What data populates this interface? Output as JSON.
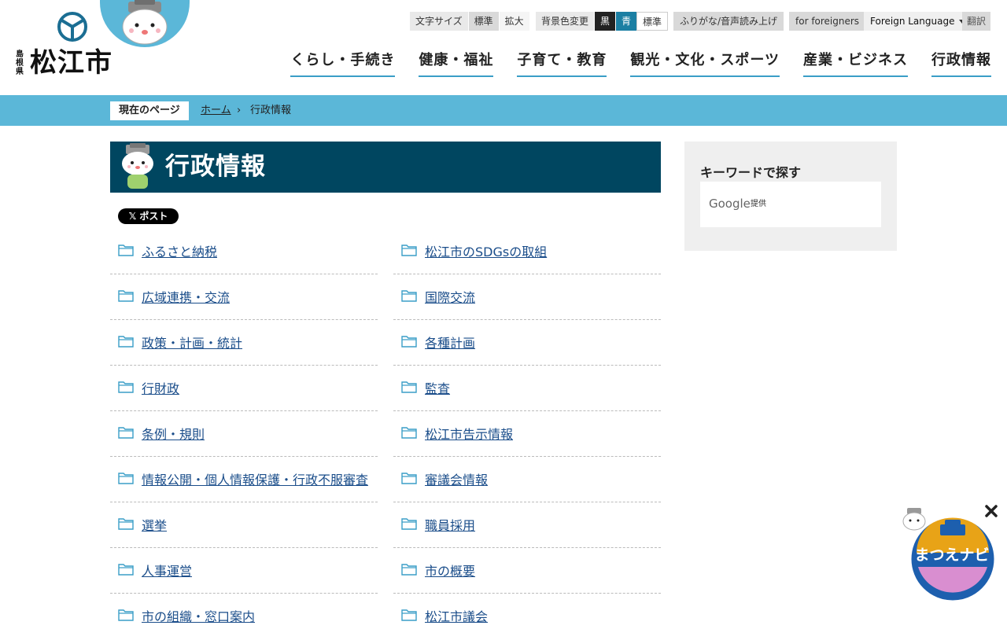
{
  "logo": {
    "prefecture": "島根県",
    "city": "松江市"
  },
  "utility": {
    "font_size_label": "文字サイズ",
    "font_size_options": [
      "標準",
      "拡大"
    ],
    "bg_label": "背景色変更",
    "bg_options": [
      "黒",
      "青",
      "標準"
    ],
    "furigana": "ふりがな/音声読み上げ",
    "foreigners": "for foreigners",
    "foreign_language": "Foreign Language",
    "translate": "翻訳"
  },
  "nav": [
    "くらし・手続き",
    "健康・福祉",
    "子育て・教育",
    "観光・文化・スポーツ",
    "産業・ビジネス",
    "行政情報"
  ],
  "breadcrumb": {
    "label": "現在のページ",
    "home": "ホーム",
    "separator": "›",
    "current": "行政情報"
  },
  "page_title": "行政情報",
  "x_post": "𝕏 ポスト",
  "links": [
    "ふるさと納税",
    "松江市のSDGsの取組",
    "広域連携・交流",
    "国際交流",
    "政策・計画・統計",
    "各種計画",
    "行財政",
    "監査",
    "条例・規則",
    "松江市告示情報",
    "情報公開・個人情報保護・行政不服審査",
    "審議会情報",
    "選挙",
    "職員採用",
    "人事運営",
    "市の概要",
    "市の組織・窓口案内",
    "松江市議会"
  ],
  "sidebar": {
    "title": "キーワードで探す",
    "google": "Google",
    "provided": "提供"
  },
  "navi": {
    "label": "まつえナビ"
  },
  "colors": {
    "accent": "#5bb7d8",
    "title_bg": "#004660",
    "link": "#1a4d8a"
  }
}
